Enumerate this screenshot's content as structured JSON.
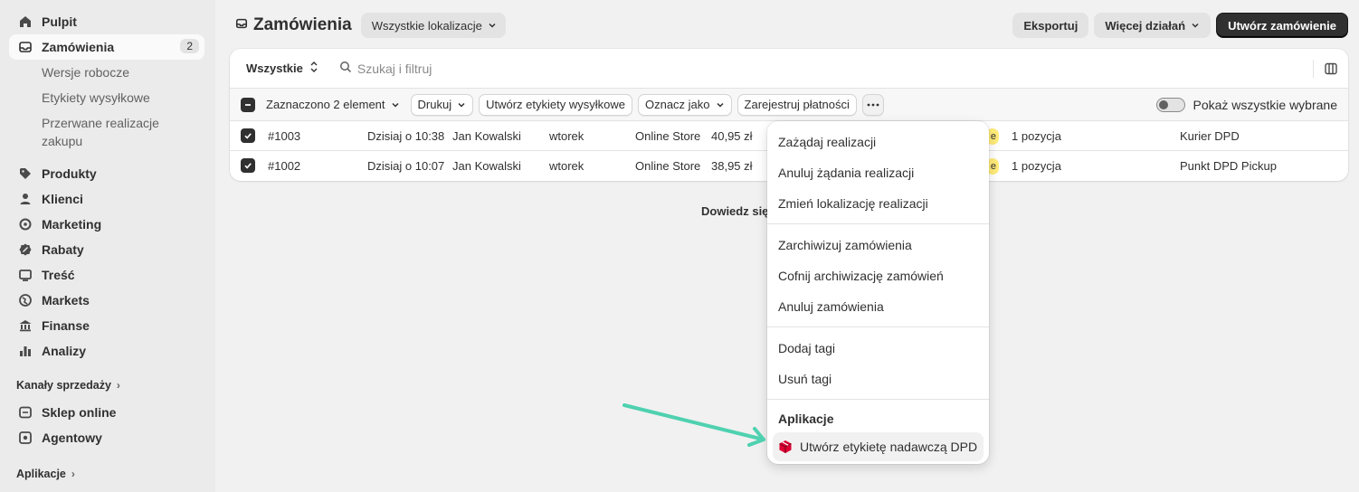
{
  "sidebar": {
    "items": [
      {
        "label": "Pulpit",
        "icon": "home-icon"
      },
      {
        "label": "Zamówienia",
        "icon": "inbox-icon",
        "badge": "2"
      },
      {
        "label": "Produkty",
        "icon": "tag-icon"
      },
      {
        "label": "Klienci",
        "icon": "person-icon"
      },
      {
        "label": "Marketing",
        "icon": "target-icon"
      },
      {
        "label": "Rabaty",
        "icon": "discount-icon"
      },
      {
        "label": "Treść",
        "icon": "content-icon"
      },
      {
        "label": "Markets",
        "icon": "globe-icon"
      },
      {
        "label": "Finanse",
        "icon": "bank-icon"
      },
      {
        "label": "Analizy",
        "icon": "chart-bar-icon"
      }
    ],
    "sub_items": [
      "Wersje robocze",
      "Etykiety wysyłkowe",
      "Przerwane realizacje zakupu"
    ],
    "sales_channels_title": "Kanały sprzedaży",
    "sales_channels": [
      {
        "label": "Sklep online",
        "icon": "store-icon"
      },
      {
        "label": "Agentowy",
        "icon": "agent-icon"
      }
    ],
    "apps_title": "Aplikacje"
  },
  "header": {
    "title": "Zamówienia",
    "location": "Wszystkie lokalizacje",
    "export": "Eksportuj",
    "more_actions": "Więcej działań",
    "create": "Utwórz zamówienie"
  },
  "filters": {
    "tab": "Wszystkie",
    "search_placeholder": "Szukaj i filtruj"
  },
  "bulk": {
    "selected": "Zaznaczono 2 element",
    "print": "Drukuj",
    "create_labels": "Utwórz etykiety wysyłkowe",
    "mark_as": "Oznacz jako",
    "register_payment": "Zarejestruj płatności",
    "show_selected": "Pokaż wszystkie wybrane"
  },
  "orders": [
    {
      "number": "#1003",
      "date": "Dzisiaj o 10:38",
      "customer": "Jan Kowalski",
      "day": "wtorek",
      "channel": "Online Store",
      "total": "40,95 zł",
      "status_fragment": "e",
      "items": "1 pozycja",
      "delivery": "Kurier DPD"
    },
    {
      "number": "#1002",
      "date": "Dzisiaj o 10:07",
      "customer": "Jan Kowalski",
      "day": "wtorek",
      "channel": "Online Store",
      "total": "38,95 zł",
      "status_fragment": "e",
      "items": "1 pozycja",
      "delivery": "Punkt DPD Pickup"
    }
  ],
  "footer_note": "Dowiedz się",
  "menu": {
    "group1": [
      "Zażądaj realizacji",
      "Anuluj żądania realizacji",
      "Zmień lokalizację realizacji"
    ],
    "group2": [
      "Zarchiwizuj zamówienia",
      "Cofnij archiwizację zamówień",
      "Anuluj zamówienia"
    ],
    "group3": [
      "Dodaj tagi",
      "Usuń tagi"
    ],
    "apps_title": "Aplikacje",
    "app_action": "Utwórz etykietę nadawczą DPD",
    "app_icon": "dpd-box-icon"
  },
  "colors": {
    "arrow": "#4fd1b0",
    "primary": "#303030",
    "dpd": "#dc0032",
    "badge_yellow": "#ffeb78"
  }
}
